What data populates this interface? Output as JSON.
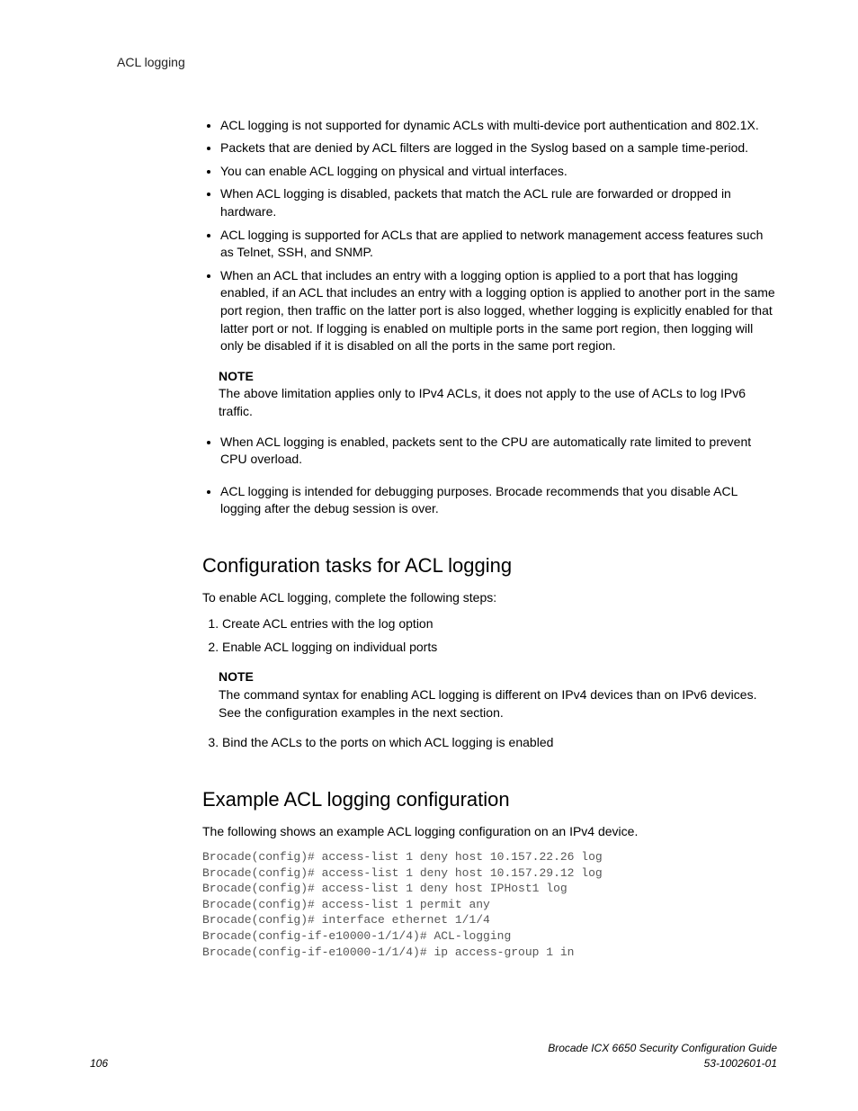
{
  "header": {
    "title": "ACL logging"
  },
  "bullets1": [
    "ACL logging is not supported for dynamic ACLs with multi-device port authentication and 802.1X.",
    "Packets that are denied by ACL filters are logged in the Syslog based on a sample time-period.",
    "You can enable ACL logging on physical and virtual interfaces.",
    "When ACL logging is disabled, packets that match the ACL rule are forwarded or dropped in hardware.",
    "ACL logging is supported for ACLs that are applied to network management access features such as Telnet, SSH,  and SNMP.",
    "When an ACL that includes an entry with a logging option is applied to a port that has logging enabled, if an ACL that includes an entry with a logging option is applied to another port in the same port region, then traffic on the latter port is also logged, whether logging is explicitly enabled for that latter port or not. If logging is enabled on multiple ports in the same port region, then logging will only be disabled if it is disabled on all the ports in the same port region."
  ],
  "note1": {
    "label": "NOTE",
    "text": "The above limitation applies only to IPv4 ACLs, it does not apply to the use of ACLs to log IPv6 traffic."
  },
  "bullets2": [
    "When ACL logging is enabled, packets sent to the CPU are automatically rate limited to prevent CPU overload.",
    "ACL logging is intended for debugging purposes. Brocade recommends that you disable ACL logging after the debug session is over."
  ],
  "section1": {
    "heading": "Configuration tasks for ACL logging",
    "intro": "To enable ACL logging, complete the following steps:",
    "steps_a": [
      "Create ACL entries with the log option",
      "Enable ACL logging on individual ports"
    ],
    "note": {
      "label": "NOTE",
      "text": "The command syntax for enabling ACL logging is different on IPv4 devices than on IPv6 devices. See the configuration examples in the next section."
    },
    "steps_b": [
      "Bind the ACLs to the ports on which ACL logging is enabled"
    ]
  },
  "section2": {
    "heading": "Example ACL logging configuration",
    "intro": "The following shows an example ACL logging configuration on an IPv4 device.",
    "code": "Brocade(config)# access-list 1 deny host 10.157.22.26 log\nBrocade(config)# access-list 1 deny host 10.157.29.12 log\nBrocade(config)# access-list 1 deny host IPHost1 log\nBrocade(config)# access-list 1 permit any\nBrocade(config)# interface ethernet 1/1/4\nBrocade(config-if-e10000-1/1/4)# ACL-logging\nBrocade(config-if-e10000-1/1/4)# ip access-group 1 in"
  },
  "footer": {
    "pagenum": "106",
    "doc_title": "Brocade ICX 6650 Security Configuration Guide",
    "doc_id": "53-1002601-01"
  }
}
